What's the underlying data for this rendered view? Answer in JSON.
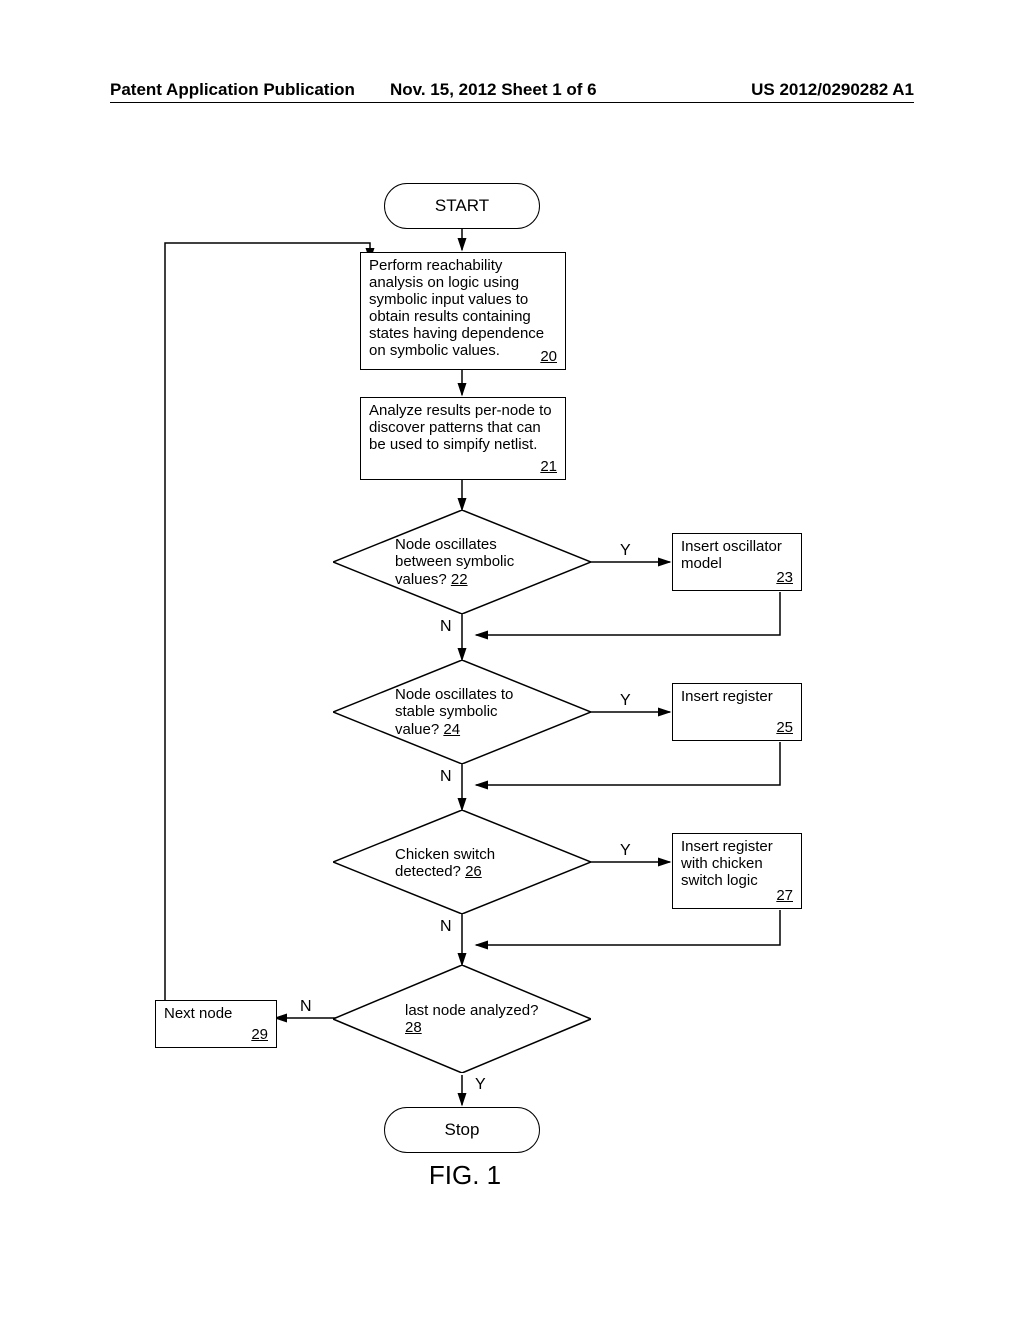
{
  "header": {
    "left": "Patent Application Publication",
    "center": "Nov. 15, 2012  Sheet 1 of 6",
    "right": "US 2012/0290282 A1"
  },
  "flowchart": {
    "start": "START",
    "stop": "Stop",
    "box20": "Perform reachability analysis on logic using symbolic input values to obtain results containing states having dependence on symbolic values.",
    "box20_ref": "20",
    "box21": "Analyze results per-node to discover patterns that can be used to simpify netlist.",
    "box21_ref": "21",
    "d22": "Node oscillates between symbolic values?",
    "d22_ref": "22",
    "box23": "Insert oscillator model",
    "box23_ref": "23",
    "d24": "Node oscillates to stable symbolic value?",
    "d24_ref": "24",
    "box25": "Insert register",
    "box25_ref": "25",
    "d26": "Chicken switch detected?",
    "d26_ref": "26",
    "box27": "Insert register with chicken switch logic",
    "box27_ref": "27",
    "d28": "last node analyzed?",
    "d28_ref": "28",
    "box29": "Next node",
    "box29_ref": "29",
    "yes": "Y",
    "no": "N",
    "figure": "FIG. 1"
  }
}
